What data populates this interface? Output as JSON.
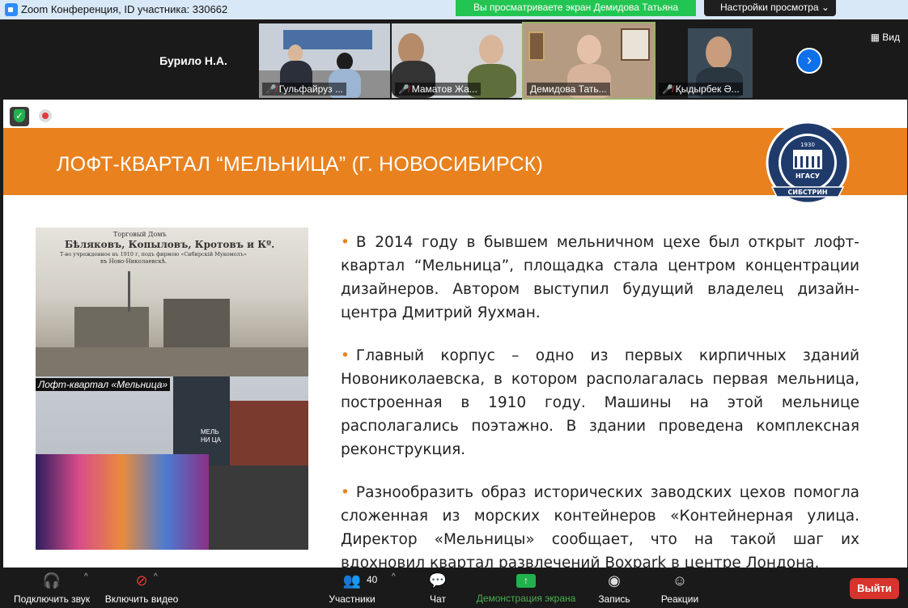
{
  "window": {
    "title": "Zoom Конференция, ID участника: 330662",
    "share_banner": "Вы просматриваете экран Демидова Татьяна",
    "view_options": "Настройки просмотра"
  },
  "participants": {
    "tiles": [
      {
        "name": "Бурило Н.А.",
        "muted": false
      },
      {
        "name": "Гульфайруз ...",
        "muted": true
      },
      {
        "name": "Маматов Жа...",
        "muted": true
      },
      {
        "name": "Демидова Тать...",
        "muted": false
      },
      {
        "name": "Қыдырбек Ә...",
        "muted": true
      }
    ],
    "view_label": "Вид"
  },
  "slide": {
    "title": "ЛОФТ-КВАРТАЛ “МЕЛЬНИЦА” (Г. НОВОСИБИРСК)",
    "logo_abbr": "НГАСУ",
    "logo_banner": "СИБСТРИН",
    "logo_year": "1930",
    "photo": {
      "caption": "Лофт-квартал «Мельница»",
      "old_line1": "Торговый Домъ",
      "old_line2": "Бѣляковъ, Копыловъ, Кротовъ и Кº.",
      "old_line3": "Т-во учрежденное въ 1910 г, подъ фирмою «Сибирскій Мукомолъ»",
      "old_line4": "въ Ново-Николаевскѣ.",
      "sign": "МЕЛЬ НИ ЦА"
    },
    "bullets": [
      "В 2014 году в бывшем мельничном цехе был открыт лофт-квартал “Мельница”, площадка стала центром концентрации дизайнеров. Автором выступил будущий владелец дизайн-центра Дмитрий Яухман.",
      "Главный корпус – одно из первых кирпичных зданий Новониколаевска, в котором располагалась первая мельница, построенная в 1910 году. Машины на этой мельнице располагались поэтажно. В здании проведена комплексная реконструкция.",
      "Разнообразить образ исторических заводских цехов помогла сложенная из морских контейнеров «Контейнерная улица. Директор «Мельницы» сообщает, что на такой шаг их вдохновил квартал развлечений Boxpark в центре Лондона."
    ]
  },
  "toolbar": {
    "unmute": "Подключить звук",
    "start_video": "Включить видео",
    "participants": "Участники",
    "participants_count": "40",
    "chat": "Чат",
    "share_screen": "Демонстрация экрана",
    "record": "Запись",
    "reactions": "Реакции",
    "leave": "Выйти"
  },
  "colors": {
    "accent_orange": "#e8811e",
    "share_green": "#23c552",
    "leave_red": "#d6342c",
    "zoom_blue": "#0e71eb"
  }
}
